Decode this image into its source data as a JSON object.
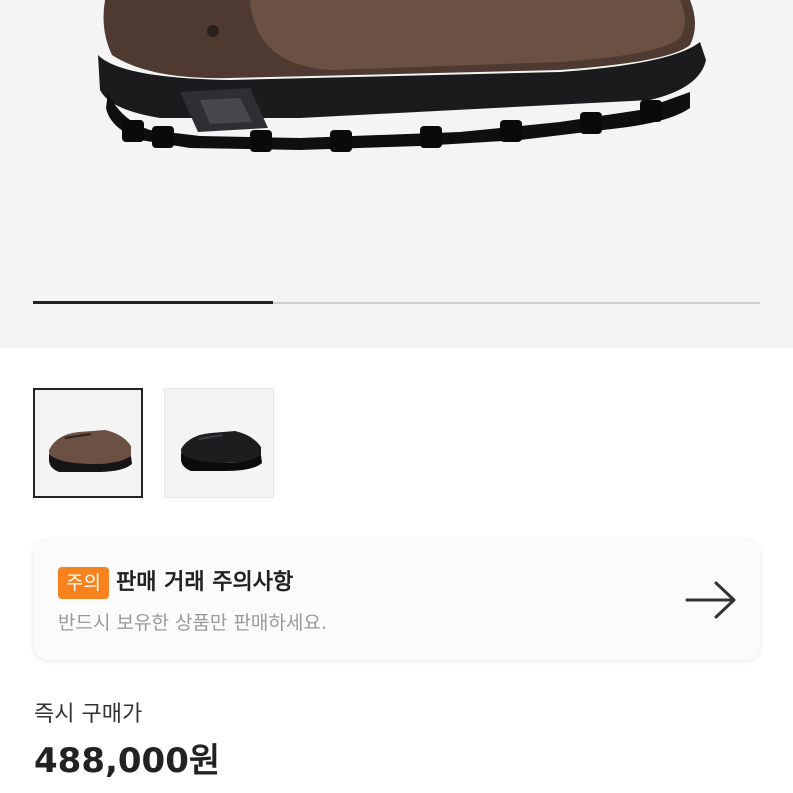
{
  "gallery": {
    "progress": 0.33,
    "thumbnails": [
      {
        "label": "brown-shoe-thumbnail",
        "selected": true
      },
      {
        "label": "black-shoe-thumbnail",
        "selected": false
      }
    ]
  },
  "notice": {
    "badge": "주의",
    "title": "판매 거래 주의사항",
    "subtitle": "반드시 보유한 상품만 판매하세요.",
    "arrow_icon": "arrow-right-icon",
    "badge_color": "#f7821e"
  },
  "price": {
    "label": "즉시 구매가",
    "value": "488,000원"
  }
}
